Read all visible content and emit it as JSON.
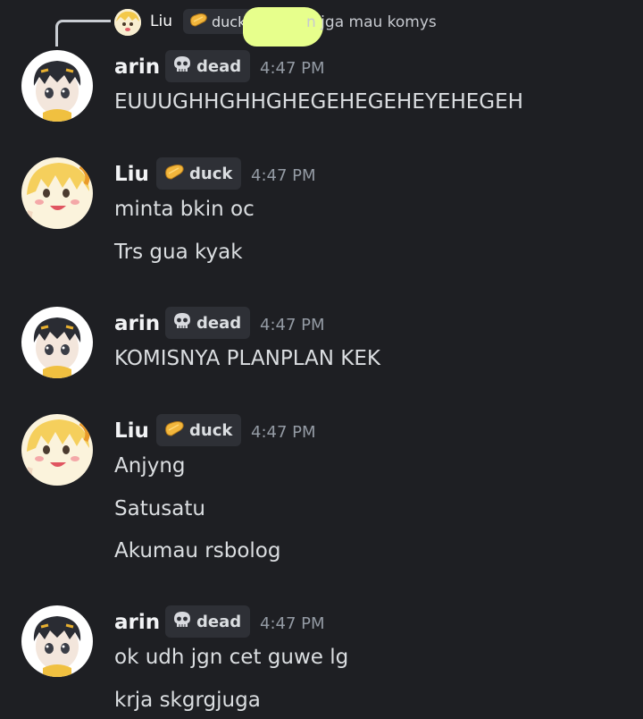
{
  "reply": {
    "author": "Liu",
    "tag": "duck",
    "text": "n jga mau komys"
  },
  "messages": [
    {
      "author": "arin",
      "tag": "dead",
      "tag_icon": "skull-icon",
      "time": "4:47 PM",
      "lines": [
        "EUUUGHHGHHGHEGEHEGEHEYEHEGEH"
      ]
    },
    {
      "author": "Liu",
      "tag": "duck",
      "tag_icon": "bread-icon",
      "time": "4:47 PM",
      "lines": [
        "minta bkin oc",
        "Trs gua kyak"
      ]
    },
    {
      "author": "arin",
      "tag": "dead",
      "tag_icon": "skull-icon",
      "time": "4:47 PM",
      "lines": [
        "KOMISNYA PLANPLAN KEK"
      ]
    },
    {
      "author": "Liu",
      "tag": "duck",
      "tag_icon": "bread-icon",
      "time": "4:47 PM",
      "lines": [
        "Anjyng",
        "Satusatu",
        "Akumau rsbolog"
      ]
    },
    {
      "author": "arin",
      "tag": "dead",
      "tag_icon": "skull-icon",
      "time": "4:47 PM",
      "lines": [
        "ok udh jgn cet guwe lg",
        "krja skgrgjuga"
      ]
    }
  ],
  "colors": {
    "background": "#1e1f23",
    "tag_background": "#2e3036",
    "timestamp": "#949ba4",
    "highlight": "#e7ff8c"
  }
}
